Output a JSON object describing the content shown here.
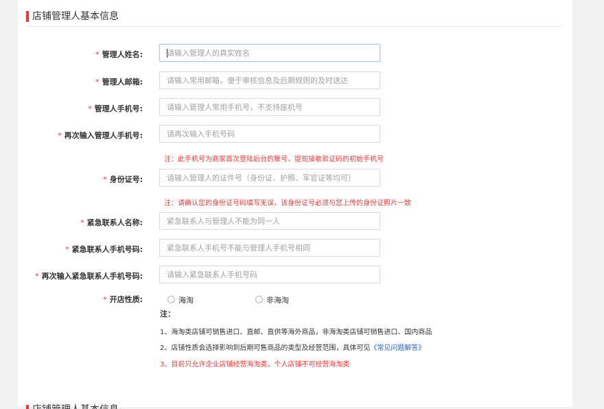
{
  "section": {
    "title": "店铺管理人基本信息"
  },
  "required_mark": "*",
  "fields": [
    {
      "label": "管理人姓名:",
      "placeholder": "请输入管理人的真实姓名"
    },
    {
      "label": "管理人邮箱:",
      "placeholder": "请输入常用邮箱，便于审核信息及后期规则的及时送达"
    },
    {
      "label": "管理人手机号:",
      "placeholder": "请输入管理人常用手机号，不支持座机号"
    },
    {
      "label": "再次输入管理人手机号:",
      "placeholder": "请再次输入手机号码"
    },
    {
      "label": "身份证号:",
      "placeholder": "请输入管理人的证件号（身份证、护照、军官证等均可）"
    },
    {
      "label": "紧急联系人名称:",
      "placeholder": "紧急联系人与管理人不能为同一人"
    },
    {
      "label": "紧急联系人手机号码:",
      "placeholder": "紧急联系人手机号不能与管理人手机号相同"
    },
    {
      "label": "再次输入紧急联系人手机号码:",
      "placeholder": "请输入紧急联系人手机号码"
    }
  ],
  "phone_note": "注：此手机号为商家首次登陆后台的账号，提现接收验证码的初始手机号",
  "id_note": "注：请确认您的身份证号码填写无误，该身份证号必须与您上传的身份证照片一致",
  "store_type": {
    "label": "开店性质:",
    "options": [
      "海淘",
      "非海淘"
    ]
  },
  "notes": {
    "heading": "注：",
    "line1": "1、海淘类店铺可销售进口、直邮、直供等海外商品，非海淘类店铺可销售进口、国内商品",
    "line2": "2、店铺性质会选择影响到后期可售商品的类型及经营范围，具体可见",
    "line2_link": "《常见问题解答》",
    "line3": "3、目前只允许企业店铺经营海淘类，个人店铺不可经营海淘类"
  },
  "next_section": {
    "title": "店铺管理人基本信息"
  },
  "colors": {
    "required": "#e4393c",
    "link": "#2d64b3",
    "accent_bar": "#e4393c"
  }
}
